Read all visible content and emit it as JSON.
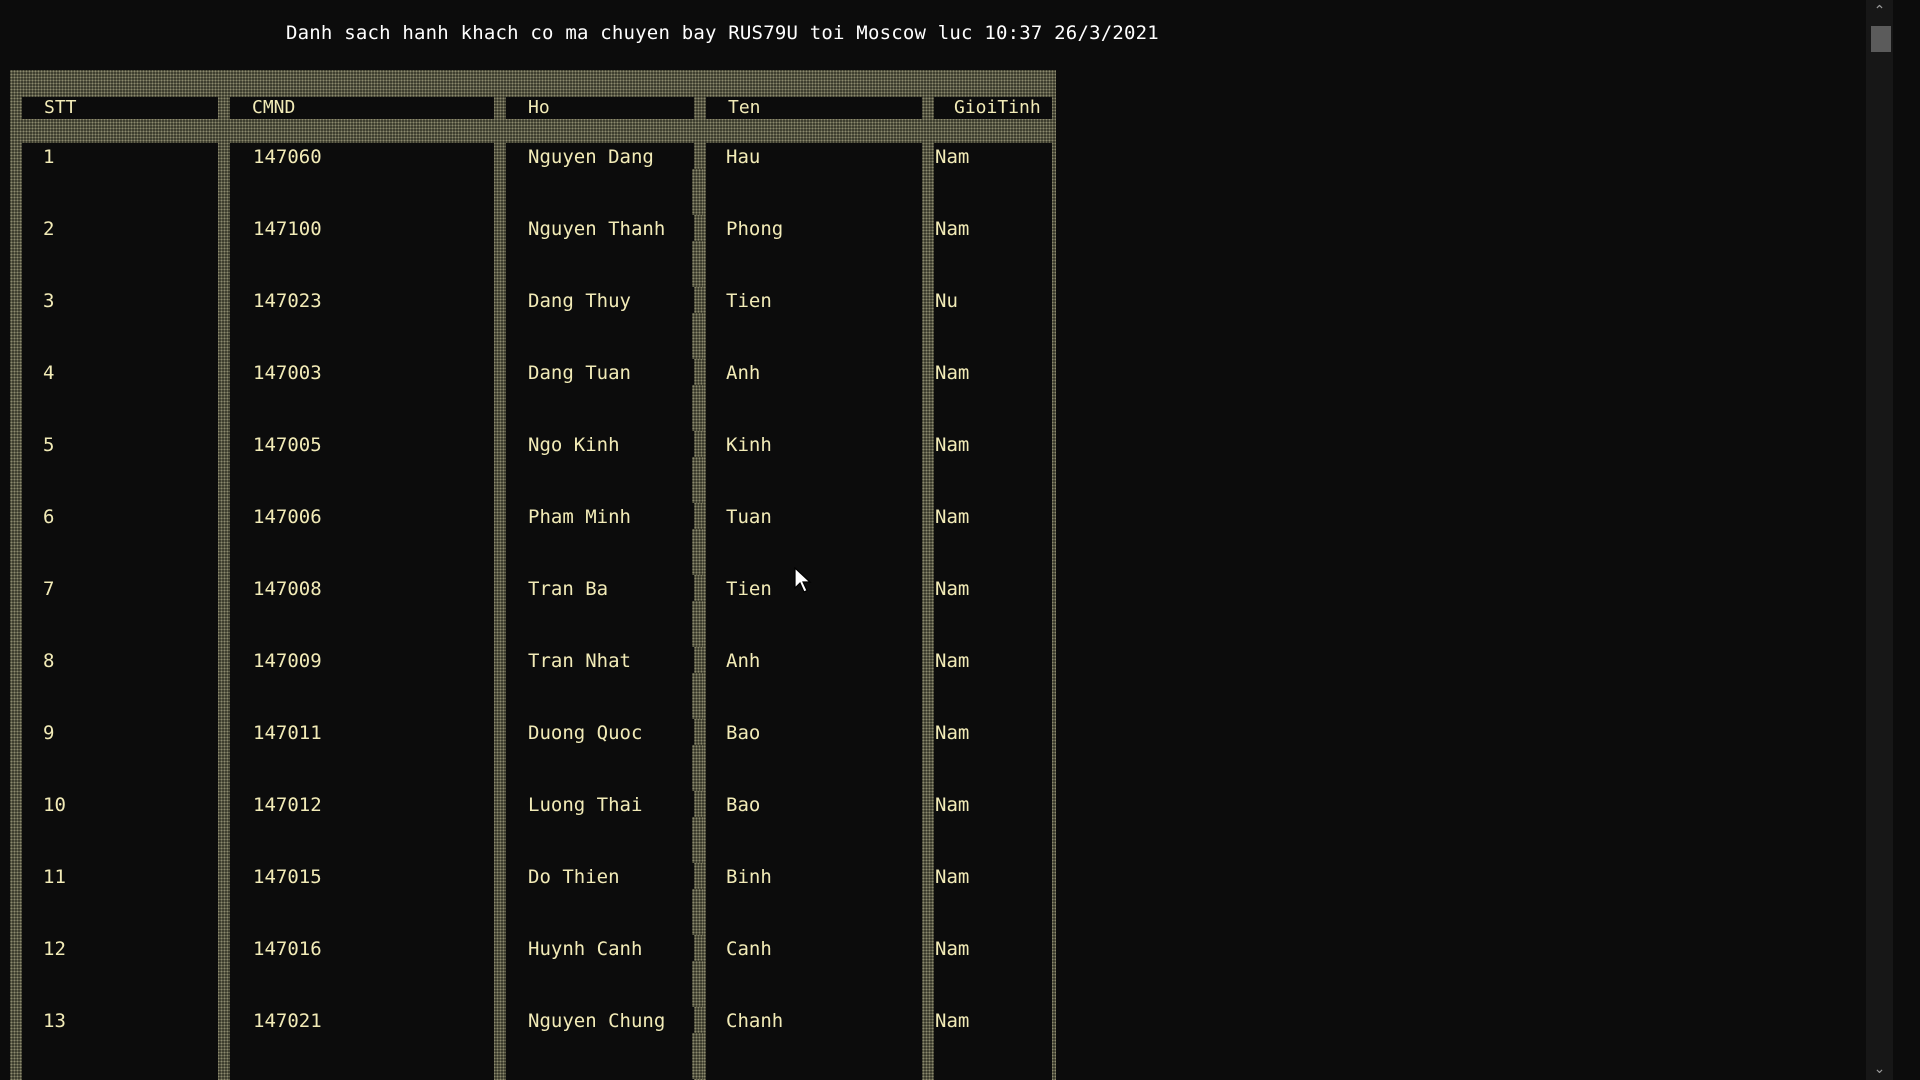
{
  "title": "Danh sach hanh khach co ma chuyen bay RUS79U toi Moscow luc 10:37 26/3/2021",
  "columns": [
    "STT",
    "CMND",
    "Ho",
    "Ten",
    "GioiTinh"
  ],
  "rows": [
    {
      "stt": "1",
      "cmnd": "147060",
      "ho": "Nguyen Dang",
      "ten": "Hau",
      "gioitinh": "Nam"
    },
    {
      "stt": "2",
      "cmnd": "147100",
      "ho": "Nguyen Thanh",
      "ten": "Phong",
      "gioitinh": "Nam"
    },
    {
      "stt": "3",
      "cmnd": "147023",
      "ho": "Dang Thuy",
      "ten": "Tien",
      "gioitinh": "Nu"
    },
    {
      "stt": "4",
      "cmnd": "147003",
      "ho": "Dang Tuan",
      "ten": "Anh",
      "gioitinh": "Nam"
    },
    {
      "stt": "5",
      "cmnd": "147005",
      "ho": "Ngo Kinh",
      "ten": "Kinh",
      "gioitinh": "Nam"
    },
    {
      "stt": "6",
      "cmnd": "147006",
      "ho": "Pham Minh",
      "ten": "Tuan",
      "gioitinh": "Nam"
    },
    {
      "stt": "7",
      "cmnd": "147008",
      "ho": "Tran Ba",
      "ten": "Tien",
      "gioitinh": "Nam"
    },
    {
      "stt": "8",
      "cmnd": "147009",
      "ho": "Tran Nhat",
      "ten": "Anh",
      "gioitinh": "Nam"
    },
    {
      "stt": "9",
      "cmnd": "147011",
      "ho": "Duong Quoc",
      "ten": "Bao",
      "gioitinh": "Nam"
    },
    {
      "stt": "10",
      "cmnd": "147012",
      "ho": "Luong Thai",
      "ten": "Bao",
      "gioitinh": "Nam"
    },
    {
      "stt": "11",
      "cmnd": "147015",
      "ho": "Do Thien",
      "ten": "Binh",
      "gioitinh": "Nam"
    },
    {
      "stt": "12",
      "cmnd": "147016",
      "ho": "Huynh Canh",
      "ten": "Canh",
      "gioitinh": "Nam"
    },
    {
      "stt": "13",
      "cmnd": "147021",
      "ho": "Nguyen Chung",
      "ten": "Chanh",
      "gioitinh": "Nam"
    }
  ],
  "colors": {
    "background": "#0c0c0c",
    "text": "#f2ebb7",
    "title_text": "#ffffff",
    "border_hatch": "#8c8a6e"
  },
  "icons": {
    "scroll_up": "chevron-up-icon",
    "scroll_down": "chevron-down-icon",
    "pointer": "mouse-pointer-icon"
  }
}
